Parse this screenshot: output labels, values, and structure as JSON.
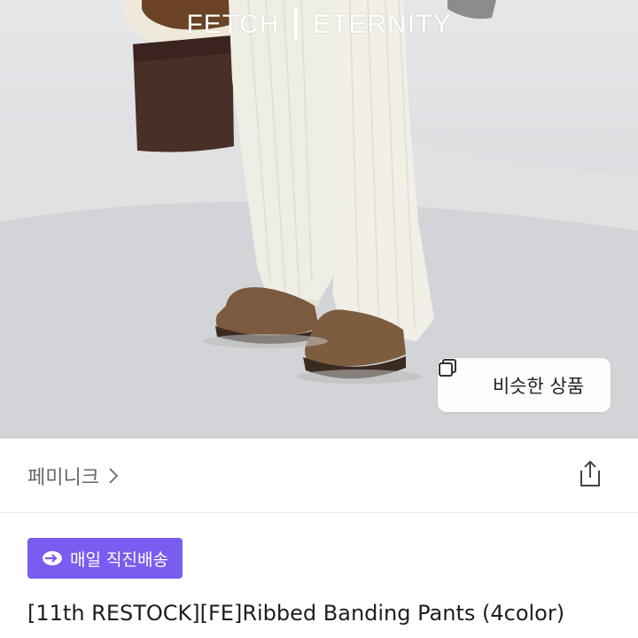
{
  "hero": {
    "brand_overlay": "FETCH ┃ ETERNITY",
    "similar_button_label": "비슷한 상품"
  },
  "shop": {
    "name": "페미니크"
  },
  "badge": {
    "label": "매일 직진배송",
    "color": "#7a5cf0"
  },
  "product": {
    "title": "[11th RESTOCK][FE]Ribbed Banding Pants (4color)"
  },
  "icons": {
    "similar": "copy-icon",
    "shop_chevron": "chevron-right-icon",
    "share": "share-icon",
    "badge": "arrow-delivery-icon"
  }
}
